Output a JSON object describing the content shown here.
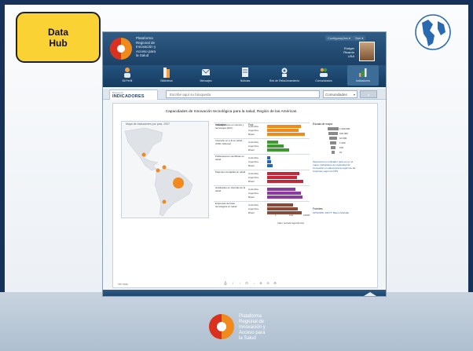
{
  "slide": {
    "badge_text": "Data\nHub",
    "footer_logo_text": "Plataforma\nRegional de\nInnovación y\nAcceso para\nla Salud",
    "colors": {
      "frame": "#16325a",
      "badge": "#fbd233",
      "brand_orange": "#f08a1c",
      "brand_red": "#d9301f"
    }
  },
  "app": {
    "title": "Plataforma\nRegional de\nInnovación y\nAcceso para\nla Salud",
    "config_label": "Configurações ▾",
    "exit_label": "Sair ▾",
    "user_name": "Rudger\nRicardo\nUSA",
    "nav": [
      {
        "label": "Mi Perfil",
        "icon": "profile-icon"
      },
      {
        "label": "Biblioteca",
        "icon": "library-icon"
      },
      {
        "label": "Mensajes",
        "icon": "messages-icon"
      },
      {
        "label": "Noticias",
        "icon": "news-icon"
      },
      {
        "label": "Red de Relacionamiento",
        "icon": "network-icon"
      },
      {
        "label": "Comunidades",
        "icon": "communities-icon"
      },
      {
        "label": "Indicadores",
        "icon": "indicators-icon",
        "active": true
      }
    ],
    "search": {
      "tab_small": "Búsqueda",
      "tab_label": "INDICADORES",
      "placeholder": "Escribe aquí su búsqueda",
      "select_value": "Comunidades",
      "button_label": "Ir"
    },
    "chart": {
      "title": "Capacidades de Innovación tecnológica para la salud, Región de las Américas",
      "map_caption": "Mapa de Indicadores por país, 2007",
      "table_headers": {
        "indicator": "Indicador",
        "country": "País"
      },
      "axis_label": "Valor (escala logarítmica)",
      "legend_title": "Escala de mapa",
      "legend_values": [
        "1 000 000",
        "100 000",
        "10 000",
        "1 000",
        "100",
        "10"
      ],
      "legend_note": "Seleccione un indicador para ver en el mapa. Indicadores de capacidad de innovación en salud para la región de las Américas según la OPS.",
      "source_title": "Fuentes",
      "source_text": "OPS/OMS, RICYT, Banco Mundial",
      "footer_left": "Ver más",
      "toolbar": [
        "⎙",
        "↕",
        "↑",
        "⊡",
        "↓",
        "⊕",
        "⊖",
        "⚙"
      ]
    }
  },
  "chart_data": {
    "type": "bar",
    "orientation": "horizontal",
    "title": "Capacidades de Innovación tecnológica para la salud, Región de las Américas",
    "log_scale": true,
    "groups": [
      {
        "indicator": "Investigadores en ciencia y tecnología (EJC)",
        "color": "#f08a1c",
        "rows": [
          {
            "country": "Colombia",
            "value": 0.86
          },
          {
            "country": "Argentina",
            "value": 0.8
          },
          {
            "country": "Brasil",
            "value": 0.95
          }
        ]
      },
      {
        "indicator": "Inversión en I+D en salud (USD millones)",
        "color": "#3c9a2e",
        "rows": [
          {
            "country": "Colombia",
            "value": 0.28
          },
          {
            "country": "Argentina",
            "value": 0.42
          },
          {
            "country": "Brasil",
            "value": 0.55
          }
        ]
      },
      {
        "indicator": "Publicaciones científicas en salud",
        "color": "#2a67b3",
        "rows": [
          {
            "country": "Colombia",
            "value": 0.08
          },
          {
            "country": "Argentina",
            "value": 0.1
          },
          {
            "country": "Brasil",
            "value": 0.14
          }
        ]
      },
      {
        "indicator": "Patentes otorgadas en salud",
        "color": "#c6283a",
        "rows": [
          {
            "country": "Colombia",
            "value": 0.82
          },
          {
            "country": "Argentina",
            "value": 0.75
          },
          {
            "country": "Brasil",
            "value": 0.92
          }
        ]
      },
      {
        "indicator": "Graduados en ciencias de la salud",
        "color": "#8a3aa0",
        "rows": [
          {
            "country": "Colombia",
            "value": 0.72
          },
          {
            "country": "Argentina",
            "value": 0.85
          },
          {
            "country": "Brasil",
            "value": 0.9
          }
        ]
      },
      {
        "indicator": "Empresas de base tecnológica en salud",
        "color": "#8a4a3a",
        "rows": [
          {
            "country": "Colombia",
            "value": 0.65
          },
          {
            "country": "Argentina",
            "value": 0.78
          },
          {
            "country": "Brasil",
            "value": 0.88
          }
        ]
      }
    ],
    "map_points": [
      {
        "country": "México",
        "size": "small"
      },
      {
        "country": "Colombia",
        "size": "small"
      },
      {
        "country": "Venezuela",
        "size": "small"
      },
      {
        "country": "Brasil",
        "size": "large"
      },
      {
        "country": "Argentina",
        "size": "small"
      }
    ]
  }
}
